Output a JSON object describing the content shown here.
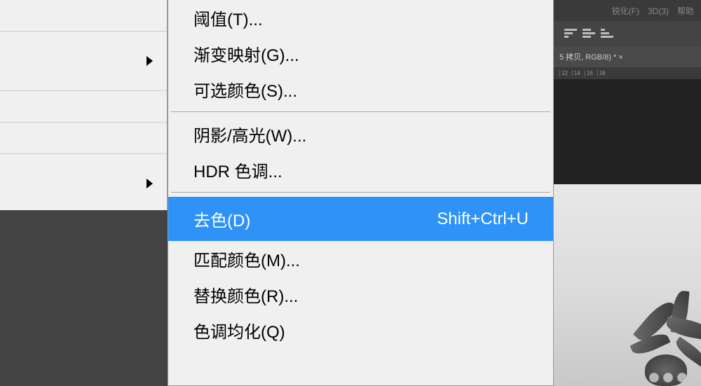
{
  "parent_menu": {
    "items": [
      {
        "has_arrow": false
      },
      {
        "has_arrow": true
      },
      {
        "has_arrow": false
      },
      {
        "has_arrow": false
      },
      {
        "has_arrow": true
      }
    ]
  },
  "submenu": {
    "group1": [
      {
        "label": "阈值(T)...",
        "shortcut": ""
      },
      {
        "label": "渐变映射(G)...",
        "shortcut": ""
      },
      {
        "label": "可选颜色(S)...",
        "shortcut": ""
      }
    ],
    "group2": [
      {
        "label": "阴影/高光(W)...",
        "shortcut": ""
      },
      {
        "label": "HDR 色调...",
        "shortcut": ""
      }
    ],
    "group3": [
      {
        "label": "去色(D)",
        "shortcut": "Shift+Ctrl+U",
        "selected": true
      },
      {
        "label": "匹配颜色(M)...",
        "shortcut": ""
      },
      {
        "label": "替换颜色(R)...",
        "shortcut": ""
      },
      {
        "label": "色调均化(Q)",
        "shortcut": ""
      }
    ]
  },
  "right_panel": {
    "top_text": "锐化(F)　3D(3)　帮助",
    "tab_text": "5 拷贝, RGB/8) * ×",
    "ruler": [
      "12",
      "14",
      "16",
      "18"
    ]
  }
}
